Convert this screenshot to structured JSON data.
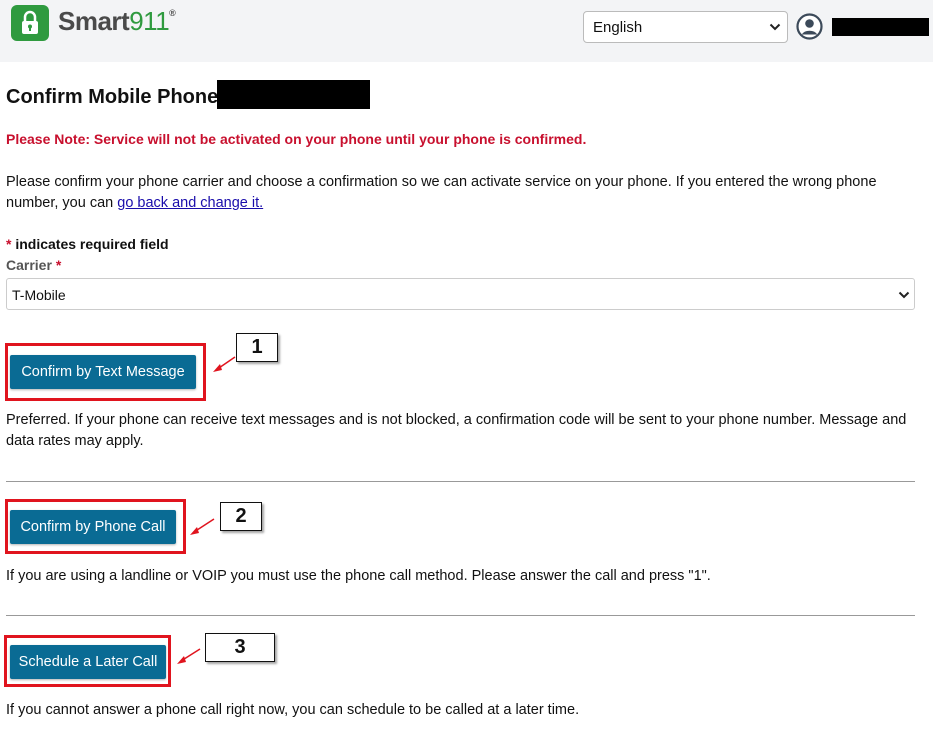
{
  "header": {
    "brand": "Smart",
    "brand_num": "911",
    "brand_mark": "®",
    "language_select": {
      "value": "English"
    }
  },
  "page": {
    "title": "Confirm Mobile Phone",
    "note": "Please Note: Service will not be activated on your phone until your phone is confirmed.",
    "intro_text": "Please confirm your phone carrier and choose a confirmation so we can activate service on your phone. If you entered the wrong phone number, you can ",
    "intro_link": "go back and change it.",
    "required_star": "*",
    "required_text": "indicates required field",
    "carrier_label": "Carrier",
    "carrier_value": "T-Mobile"
  },
  "options": [
    {
      "button": "Confirm by Text Message",
      "callout": "1",
      "description": "Preferred. If your phone can receive text messages and is not blocked, a confirmation code will be sent to your phone number. Message and data rates may apply."
    },
    {
      "button": "Confirm by Phone Call",
      "callout": "2",
      "description": "If you are using a landline or VOIP you must use the phone call method. Please answer the call and press \"1\"."
    },
    {
      "button": "Schedule a Later Call",
      "callout": "3",
      "description": "If you cannot answer a phone call right now, you can schedule to be called at a later time."
    }
  ],
  "colors": {
    "button": "#0a6b94",
    "highlight": "#e0141e",
    "note": "#c8102e",
    "brand_green": "#2f9a3f"
  },
  "icons": {
    "logo": "lock-icon",
    "user": "user-circle-icon",
    "dropdown": "chevron-down-icon",
    "pointer": "arrow-icon"
  }
}
